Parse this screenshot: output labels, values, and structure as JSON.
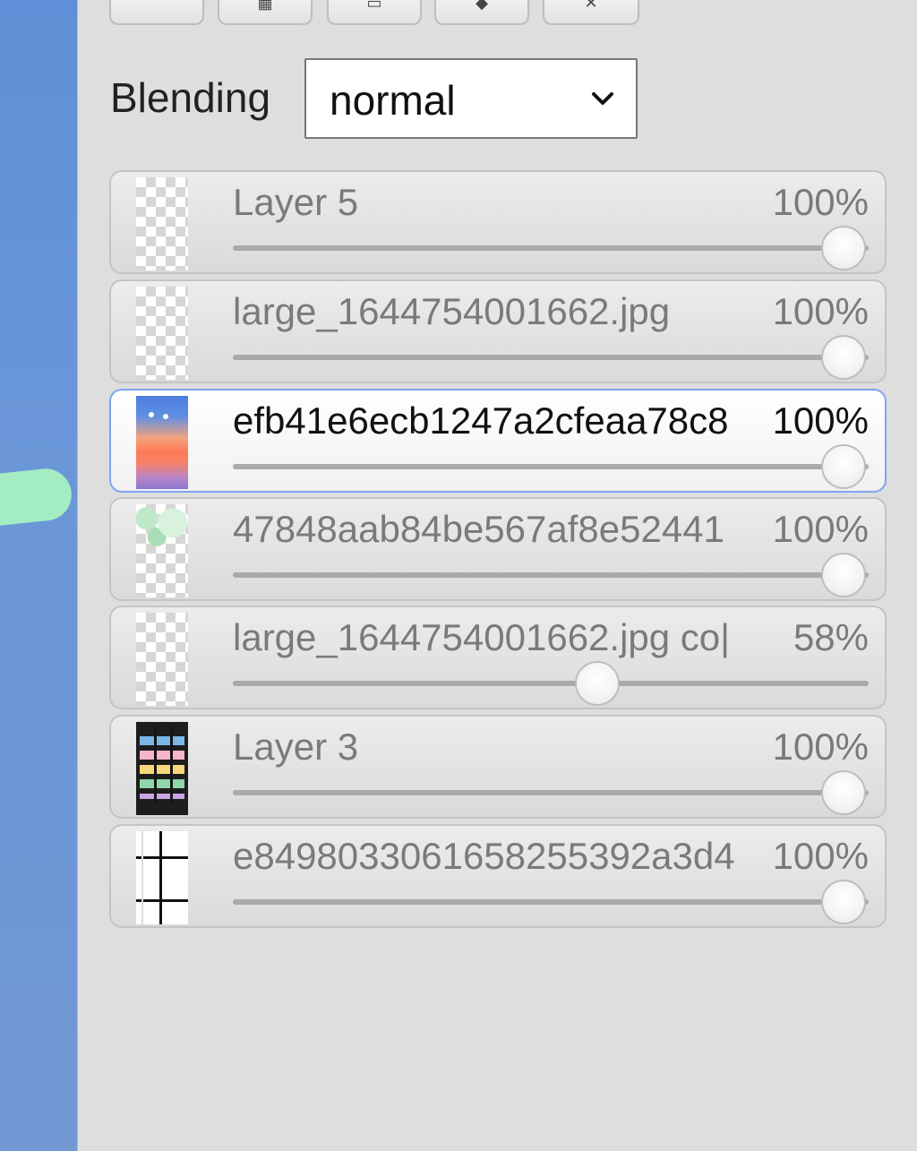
{
  "toolbar": {
    "buttons": [
      {
        "name": "new-layer-button",
        "icon": "blank-icon"
      },
      {
        "name": "duplicate-layer-button",
        "icon": "grid-icon"
      },
      {
        "name": "merge-layer-button",
        "icon": "square-icon"
      },
      {
        "name": "layer-stack-button",
        "icon": "stack-icon"
      },
      {
        "name": "delete-layer-button",
        "icon": "close-icon"
      }
    ]
  },
  "blending": {
    "label": "Blending",
    "value": "normal"
  },
  "layers": [
    {
      "name": "Layer 5",
      "opacity_label": "100%",
      "opacity": 1.0,
      "thumb": "transparent",
      "active": false
    },
    {
      "name": "large_1644754001662.jpg",
      "opacity_label": "100%",
      "opacity": 1.0,
      "thumb": "transparent",
      "active": false
    },
    {
      "name": "efb41e6ecb1247a2cfeaa78c8",
      "opacity_label": "100%",
      "opacity": 1.0,
      "thumb": "sky",
      "active": true
    },
    {
      "name": "47848aab84be567af8e52441",
      "opacity_label": "100%",
      "opacity": 1.0,
      "thumb": "green",
      "active": false
    },
    {
      "name": "large_1644754001662.jpg co|",
      "opacity_label": "58%",
      "opacity": 0.58,
      "thumb": "transparent",
      "active": false
    },
    {
      "name": "Layer 3",
      "opacity_label": "100%",
      "opacity": 1.0,
      "thumb": "bars",
      "active": false
    },
    {
      "name": "e8498033061658255392a3d4",
      "opacity_label": "100%",
      "opacity": 1.0,
      "thumb": "grid",
      "active": false
    }
  ],
  "colors": {
    "active_border": "#7ea6f0",
    "canvas_blue": "#6a95d6",
    "brush_green": "#a8f0c0"
  }
}
